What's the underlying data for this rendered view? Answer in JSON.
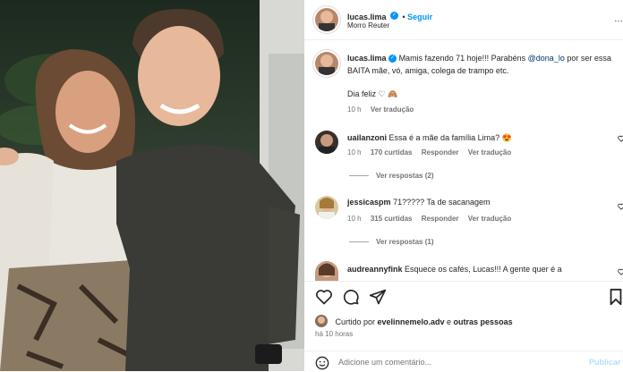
{
  "post": {
    "username": "lucas.lima",
    "follow_label": "Seguir",
    "location": "Morro Reuter",
    "caption_prefix": "Mamis fazendo 71 hoje!!! Parabéns ",
    "caption_mention": "@dona_lo",
    "caption_suffix": " por ser essa BAITA mãe, vó, amiga, colega de trampo etc.",
    "caption_line2": "Dia feliz ♡ 🙈",
    "caption_time": "10 h",
    "caption_translate": "Ver tradução"
  },
  "comments": [
    {
      "username": "uailanzoni",
      "text": "Essa é a mãe da família Lima? 😍",
      "time": "10 h",
      "likes": "170 curtidas",
      "reply": "Responder",
      "translate": "Ver tradução",
      "replies": "Ver respostas (2)"
    },
    {
      "username": "jessicaspm",
      "text": "71????? Ta de sacanagem",
      "time": "10 h",
      "likes": "315 curtidas",
      "reply": "Responder",
      "translate": "Ver tradução",
      "replies": "Ver respostas (1)"
    },
    {
      "username": "audreannyfink",
      "text": "Esquece os cafés, Lucas!!! A gente quer é a"
    }
  ],
  "likes": {
    "prefix": "Curtido por ",
    "user": "evelinnemelo.adv",
    "middle": " e ",
    "others": "outras pessoas"
  },
  "timestamp": "há 10 horas",
  "comment_box": {
    "placeholder": "Adicione um comentário...",
    "publish_label": "Publicar"
  },
  "colors": {
    "accent": "#0095f6",
    "text": "#262626",
    "muted": "#737373"
  }
}
